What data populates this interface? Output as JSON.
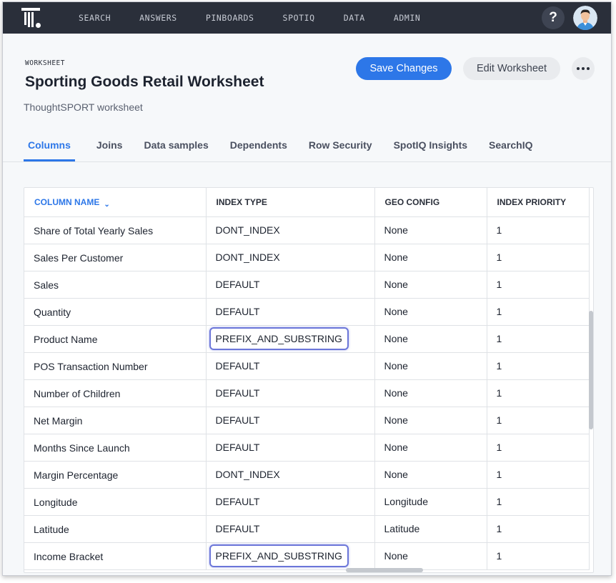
{
  "nav": {
    "items": [
      "SEARCH",
      "ANSWERS",
      "PINBOARDS",
      "SPOTIQ",
      "DATA",
      "ADMIN"
    ],
    "help_label": "?"
  },
  "header": {
    "overline": "WORKSHEET",
    "title": "Sporting Goods Retail Worksheet",
    "subtitle": "ThoughtSPORT worksheet",
    "save_label": "Save Changes",
    "edit_label": "Edit Worksheet"
  },
  "tabs": [
    "Columns",
    "Joins",
    "Data samples",
    "Dependents",
    "Row Security",
    "SpotIQ Insights",
    "SearchIQ"
  ],
  "active_tab": "Columns",
  "table": {
    "headers": [
      "COLUMN NAME",
      "INDEX TYPE",
      "GEO CONFIG",
      "INDEX PRIORITY"
    ],
    "rows": [
      [
        "Share of Total Yearly Sales",
        "DONT_INDEX",
        "None",
        "1"
      ],
      [
        "Sales Per Customer",
        "DONT_INDEX",
        "None",
        "1"
      ],
      [
        "Sales",
        "DEFAULT",
        "None",
        "1"
      ],
      [
        "Quantity",
        "DEFAULT",
        "None",
        "1"
      ],
      [
        "Product Name",
        "PREFIX_AND_SUBSTRING",
        "None",
        "1"
      ],
      [
        "POS Transaction Number",
        "DEFAULT",
        "None",
        "1"
      ],
      [
        "Number of Children",
        "DEFAULT",
        "None",
        "1"
      ],
      [
        "Net Margin",
        "DEFAULT",
        "None",
        "1"
      ],
      [
        "Months Since Launch",
        "DEFAULT",
        "None",
        "1"
      ],
      [
        "Margin Percentage",
        "DONT_INDEX",
        "None",
        "1"
      ],
      [
        "Longitude",
        "DEFAULT",
        "Longitude",
        "1"
      ],
      [
        "Latitude",
        "DEFAULT",
        "Latitude",
        "1"
      ],
      [
        "Income Bracket",
        "PREFIX_AND_SUBSTRING",
        "None",
        "1"
      ]
    ],
    "highlighted_rows": [
      4,
      12
    ]
  },
  "colors": {
    "nav_bg": "#2a2f3a",
    "accent": "#2d77e8",
    "highlight": "#6b76d9"
  }
}
